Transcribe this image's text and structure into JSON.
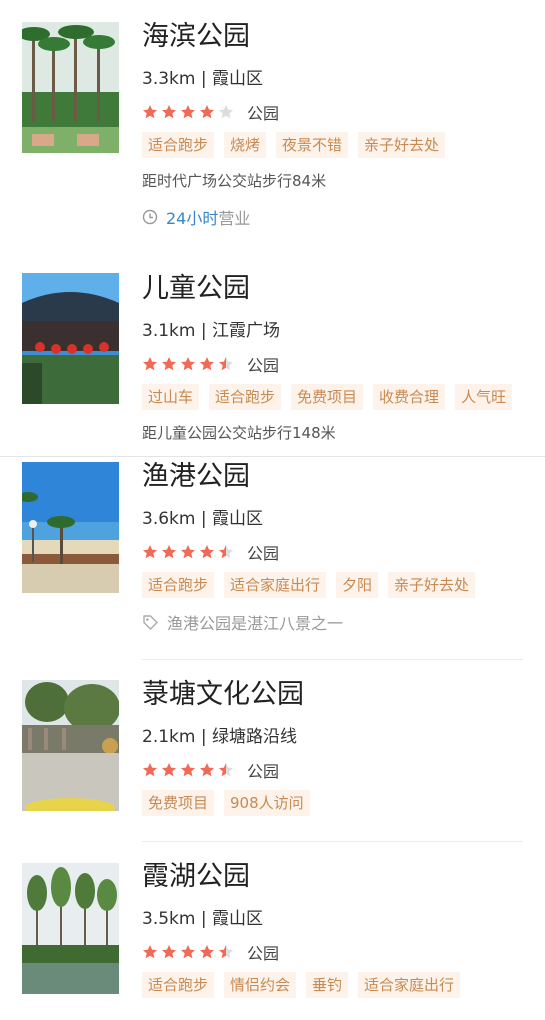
{
  "parks": [
    {
      "name": "海滨公园",
      "meta": "3.3km | 霞山区",
      "rating": 4,
      "category": "公园",
      "tags": [
        "适合跑步",
        "烧烤",
        "夜景不错",
        "亲子好去处"
      ],
      "note": "距时代广场公交站步行84米",
      "hours_highlight": "24小时",
      "hours_suffix": "营业"
    },
    {
      "name": "儿童公园",
      "meta": "3.1km | 江霞广场",
      "rating": 4.5,
      "category": "公园",
      "tags": [
        "过山车",
        "适合跑步",
        "免费项目",
        "收费合理",
        "人气旺"
      ],
      "note": "距儿童公园公交站步行148米"
    },
    {
      "name": "渔港公园",
      "meta": "3.6km | 霞山区",
      "rating": 4.5,
      "category": "公园",
      "tags": [
        "适合跑步",
        "适合家庭出行",
        "夕阳",
        "亲子好去处"
      ],
      "intro": "渔港公园是湛江八景之一"
    },
    {
      "name": "菉塘文化公园",
      "meta": "2.1km | 绿塘路沿线",
      "rating": 4.5,
      "category": "公园",
      "tags": [
        "免费项目",
        "908人访问"
      ]
    },
    {
      "name": "霞湖公园",
      "meta": "3.5km | 霞山区",
      "rating": 4.5,
      "category": "公园",
      "tags": [
        "适合跑步",
        "情侣约会",
        "垂钓",
        "适合家庭出行"
      ]
    }
  ],
  "colors": {
    "star": "#f06a55",
    "star_empty": "#dddddd",
    "tag_bg": "#fdf3ea",
    "tag_text": "#c88a52",
    "link": "#3a86c8"
  }
}
